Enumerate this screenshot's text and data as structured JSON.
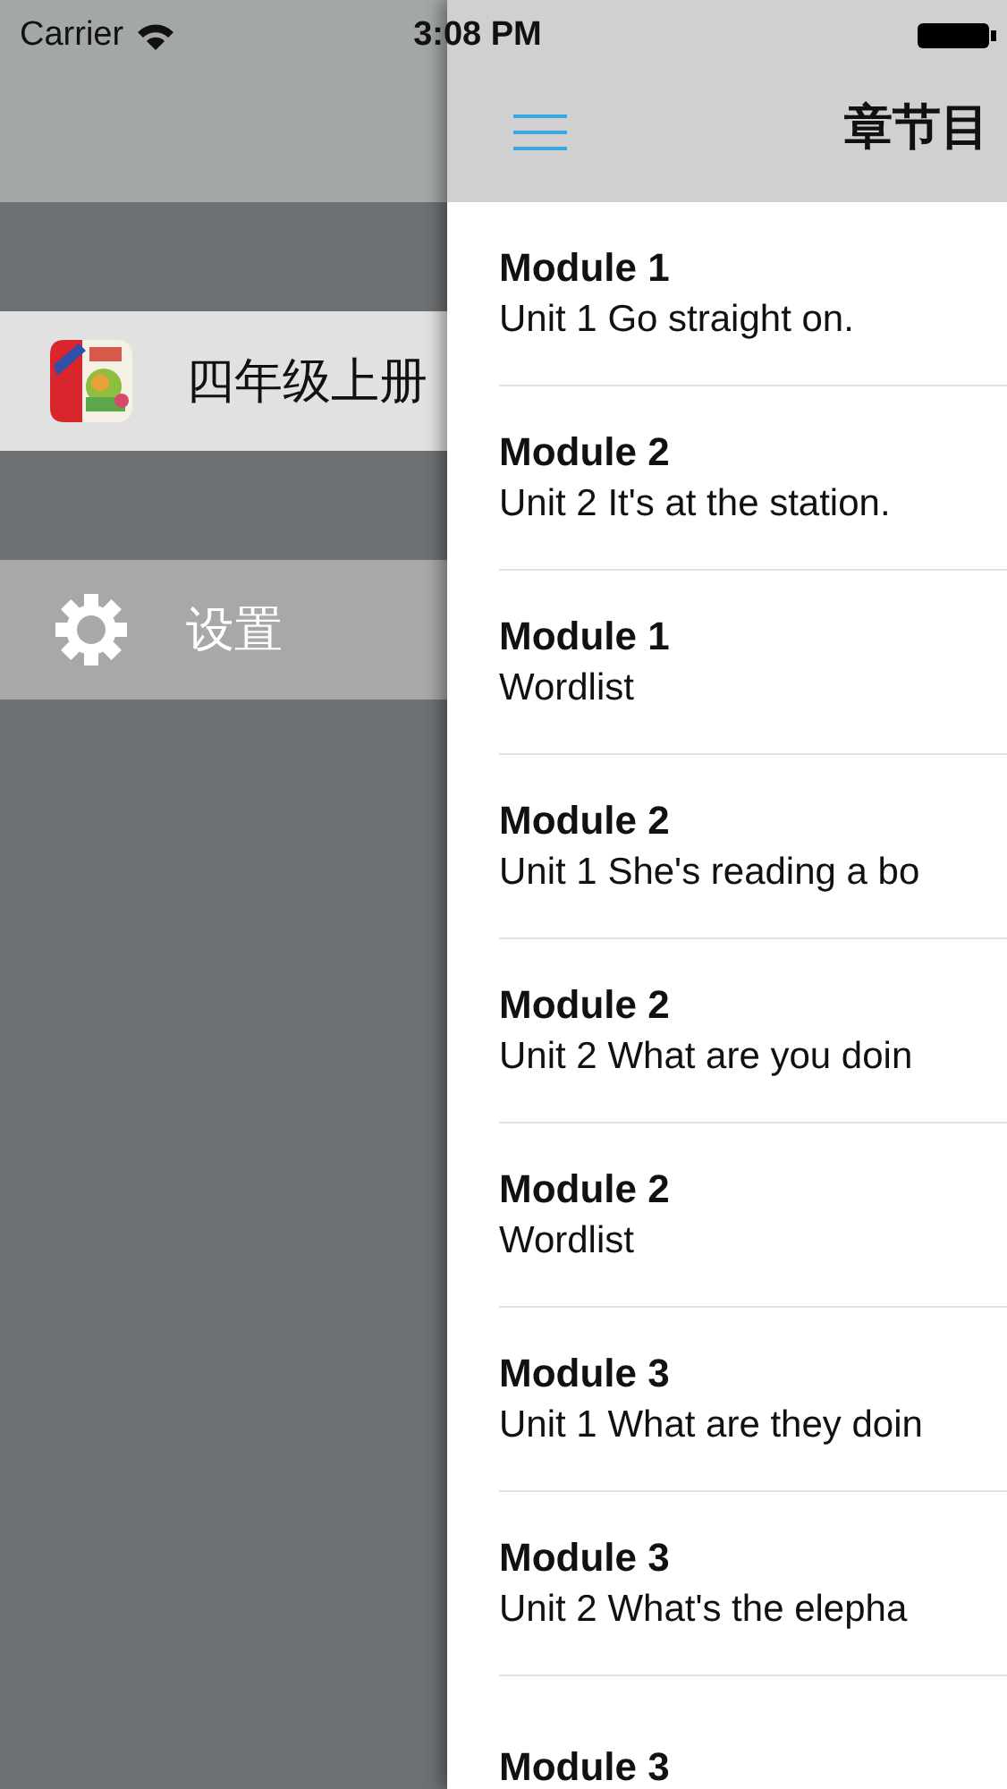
{
  "status_bar": {
    "carrier": "Carrier",
    "time": "3:08 PM"
  },
  "drawer": {
    "items": [
      {
        "label": "四年级上册",
        "kind": "book",
        "selected": true
      },
      {
        "label": "设置",
        "kind": "settings",
        "selected": false
      }
    ]
  },
  "nav": {
    "title": "章节目"
  },
  "chapters": [
    {
      "module": "Module 1",
      "title": "Unit 1 Go straight on."
    },
    {
      "module": "Module 2",
      "title": "Unit 2 It's at the station."
    },
    {
      "module": "Module 1",
      "title": "Wordlist"
    },
    {
      "module": "Module 2",
      "title": "Unit 1 She's reading a bo"
    },
    {
      "module": "Module 2",
      "title": "Unit 2 What are you doin"
    },
    {
      "module": "Module 2",
      "title": "Wordlist"
    },
    {
      "module": "Module 3",
      "title": "Unit 1 What are they doin"
    },
    {
      "module": "Module 3",
      "title": "Unit 2 What's the elepha"
    },
    {
      "module": "Module 3"
    }
  ]
}
